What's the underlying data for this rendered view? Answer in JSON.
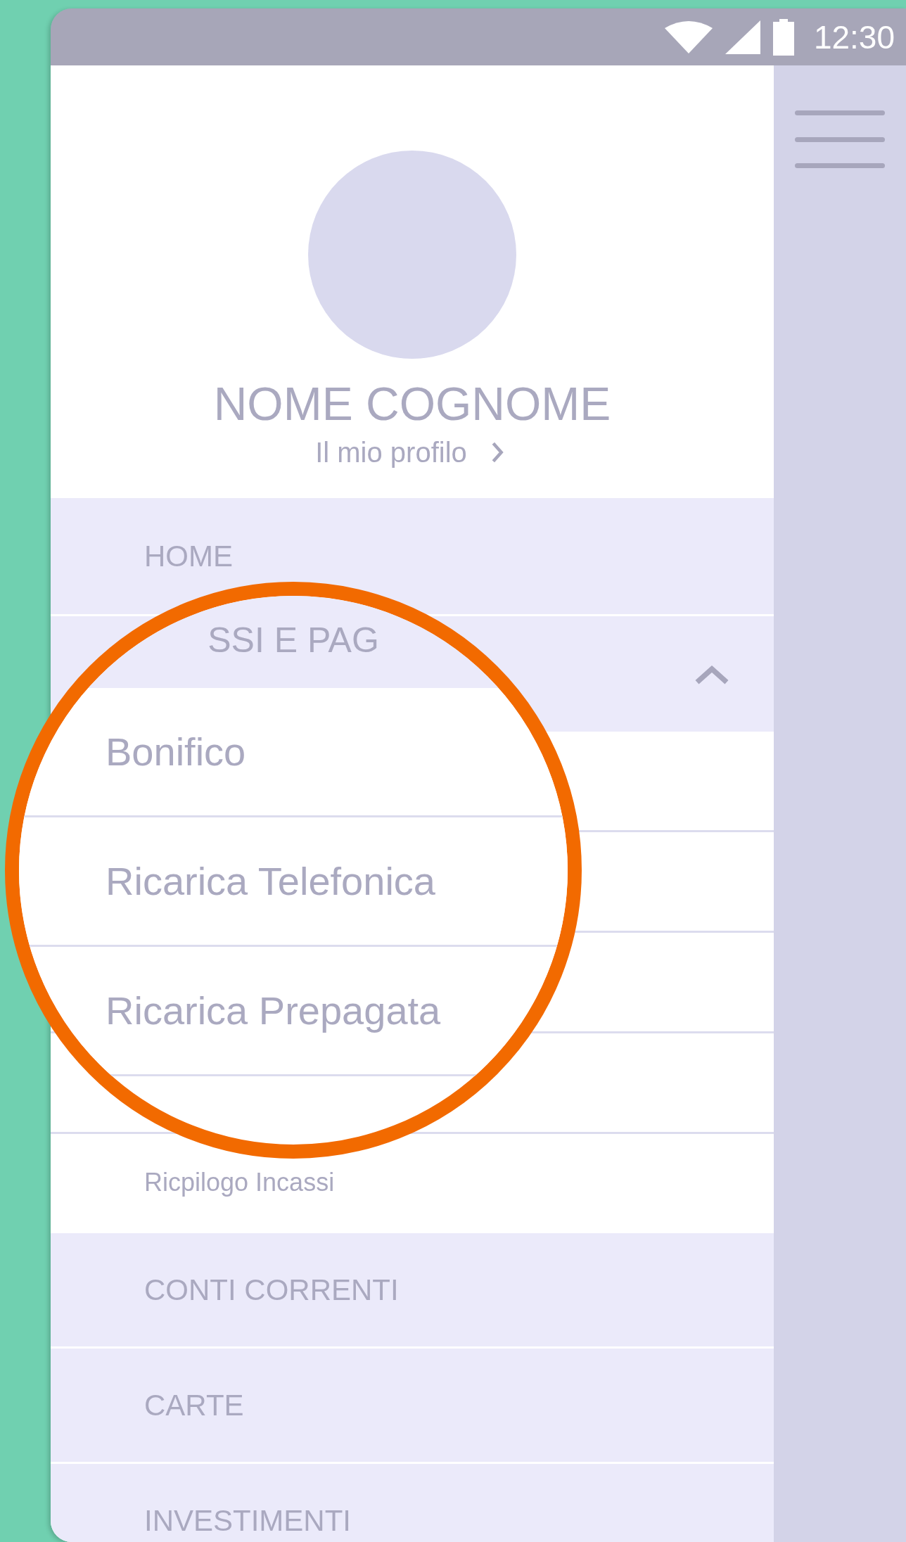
{
  "status_bar": {
    "time": "12:30"
  },
  "profile": {
    "name": "NOME COGNOME",
    "link": "Il mio profilo"
  },
  "menu": [
    {
      "kind": "section",
      "label": "HOME"
    },
    {
      "kind": "group",
      "expanded": true,
      "children": [
        {
          "label": "Ricpilogo Incassi"
        }
      ]
    },
    {
      "kind": "section",
      "label": "CONTI CORRENTI"
    },
    {
      "kind": "section",
      "label": "CARTE"
    },
    {
      "kind": "section",
      "label": "INVESTIMENTI"
    }
  ],
  "magnifier": {
    "heading": "SSI E PAG",
    "items": [
      {
        "label": "Bonifico"
      },
      {
        "label": "Ricarica Telefonica"
      },
      {
        "label": "Ricarica Prepagata"
      }
    ]
  }
}
